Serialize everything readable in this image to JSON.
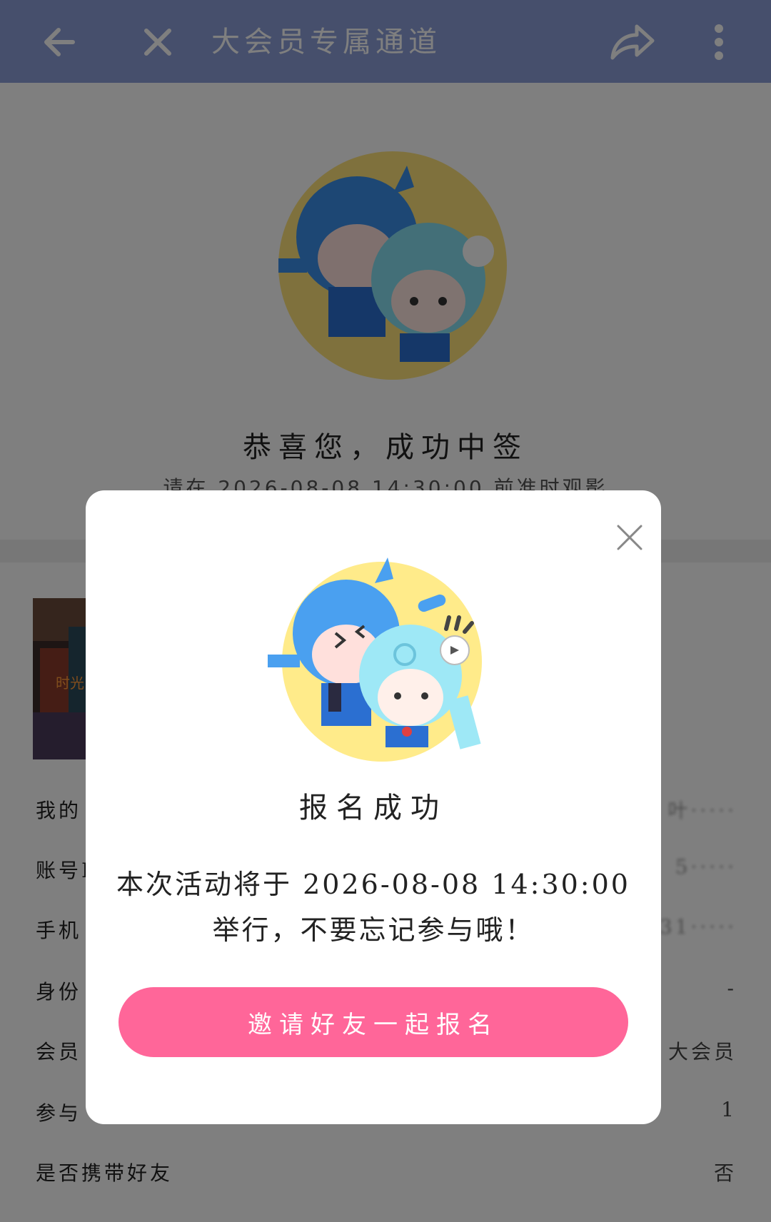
{
  "top_bar": {
    "title": "大会员专属通道",
    "icons": [
      "back-arrow-icon",
      "close-icon",
      "share-icon",
      "more-vertical-icon"
    ],
    "color": "#8c9fd9"
  },
  "hero": {
    "title": "恭喜您，成功中签",
    "subtitle": "请在 2026-08-08 14:30:00 前准时观影"
  },
  "info": {
    "rows": [
      {
        "label": "我的",
        "value": "叶·····"
      },
      {
        "label": "账号I",
        "value": "5·····"
      },
      {
        "label": "手机",
        "value": "31·····"
      },
      {
        "label": "身份",
        "value": "-"
      },
      {
        "label": "会员",
        "value": "大会员"
      },
      {
        "label": "参与",
        "value": "1"
      },
      {
        "label": "是否携带好友",
        "value": "否"
      }
    ],
    "poster_text": "时光"
  },
  "modal": {
    "title": "报名成功",
    "message_line1": "本次活动将于 2026-08-08 14:30:00",
    "message_line2": "举行，不要忘记参与哦！",
    "button_label": "邀请好友一起报名",
    "button_color": "#ff6699"
  }
}
